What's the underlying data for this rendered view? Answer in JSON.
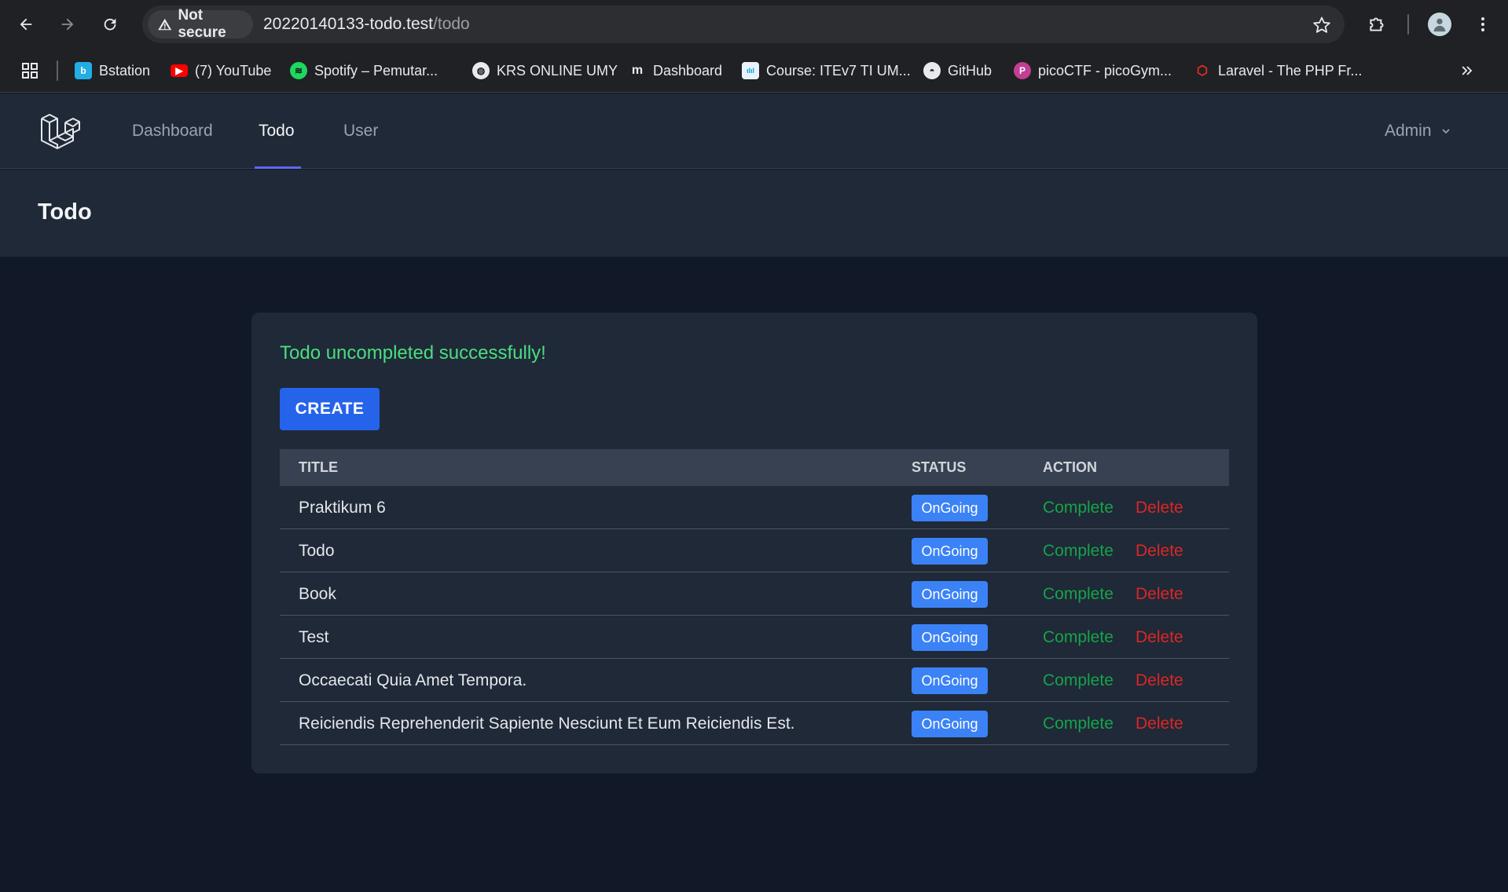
{
  "browser": {
    "security_label": "Not secure",
    "url_host": "20220140133-todo.test",
    "url_path": "/todo",
    "bookmarks": [
      {
        "label": "Bstation",
        "icon": "bstation-icon",
        "color": "#23ade5"
      },
      {
        "label": "(7) YouTube",
        "icon": "youtube-icon",
        "color": "#ff0000"
      },
      {
        "label": "Spotify – Pemutar...",
        "icon": "spotify-icon",
        "color": "#1ed760"
      },
      {
        "label": "KRS ONLINE UMY",
        "icon": "globe-icon",
        "color": "#e8eaed"
      },
      {
        "label": "Dashboard",
        "icon": "moodle-icon",
        "color": "#e8eaed"
      },
      {
        "label": "Course: ITEv7 TI UM...",
        "icon": "cisco-icon",
        "color": "#049fd9"
      },
      {
        "label": "GitHub",
        "icon": "github-icon",
        "color": "#e8eaed"
      },
      {
        "label": "picoCTF - picoGym...",
        "icon": "picoctf-icon",
        "color": "#c13f94"
      },
      {
        "label": "Laravel - The PHP Fr...",
        "icon": "laravel-icon",
        "color": "#ff2d20"
      }
    ]
  },
  "nav": {
    "links": [
      {
        "label": "Dashboard",
        "active": false
      },
      {
        "label": "Todo",
        "active": true
      },
      {
        "label": "User",
        "active": false
      }
    ],
    "user": "Admin"
  },
  "header": {
    "title": "Todo"
  },
  "main": {
    "flash": "Todo uncompleted successfully!",
    "create_label": "CREATE",
    "table": {
      "columns": [
        "TITLE",
        "STATUS",
        "ACTION"
      ],
      "rows": [
        {
          "title": "Praktikum 6",
          "status": "OnGoing",
          "complete": "Complete",
          "delete": "Delete"
        },
        {
          "title": "Todo",
          "status": "OnGoing",
          "complete": "Complete",
          "delete": "Delete"
        },
        {
          "title": "Book",
          "status": "OnGoing",
          "complete": "Complete",
          "delete": "Delete"
        },
        {
          "title": "Test",
          "status": "OnGoing",
          "complete": "Complete",
          "delete": "Delete"
        },
        {
          "title": "Occaecati Quia Amet Tempora.",
          "status": "OnGoing",
          "complete": "Complete",
          "delete": "Delete"
        },
        {
          "title": "Reiciendis Reprehenderit Sapiente Nesciunt Et Eum Reiciendis Est.",
          "status": "OnGoing",
          "complete": "Complete",
          "delete": "Delete"
        }
      ]
    }
  }
}
